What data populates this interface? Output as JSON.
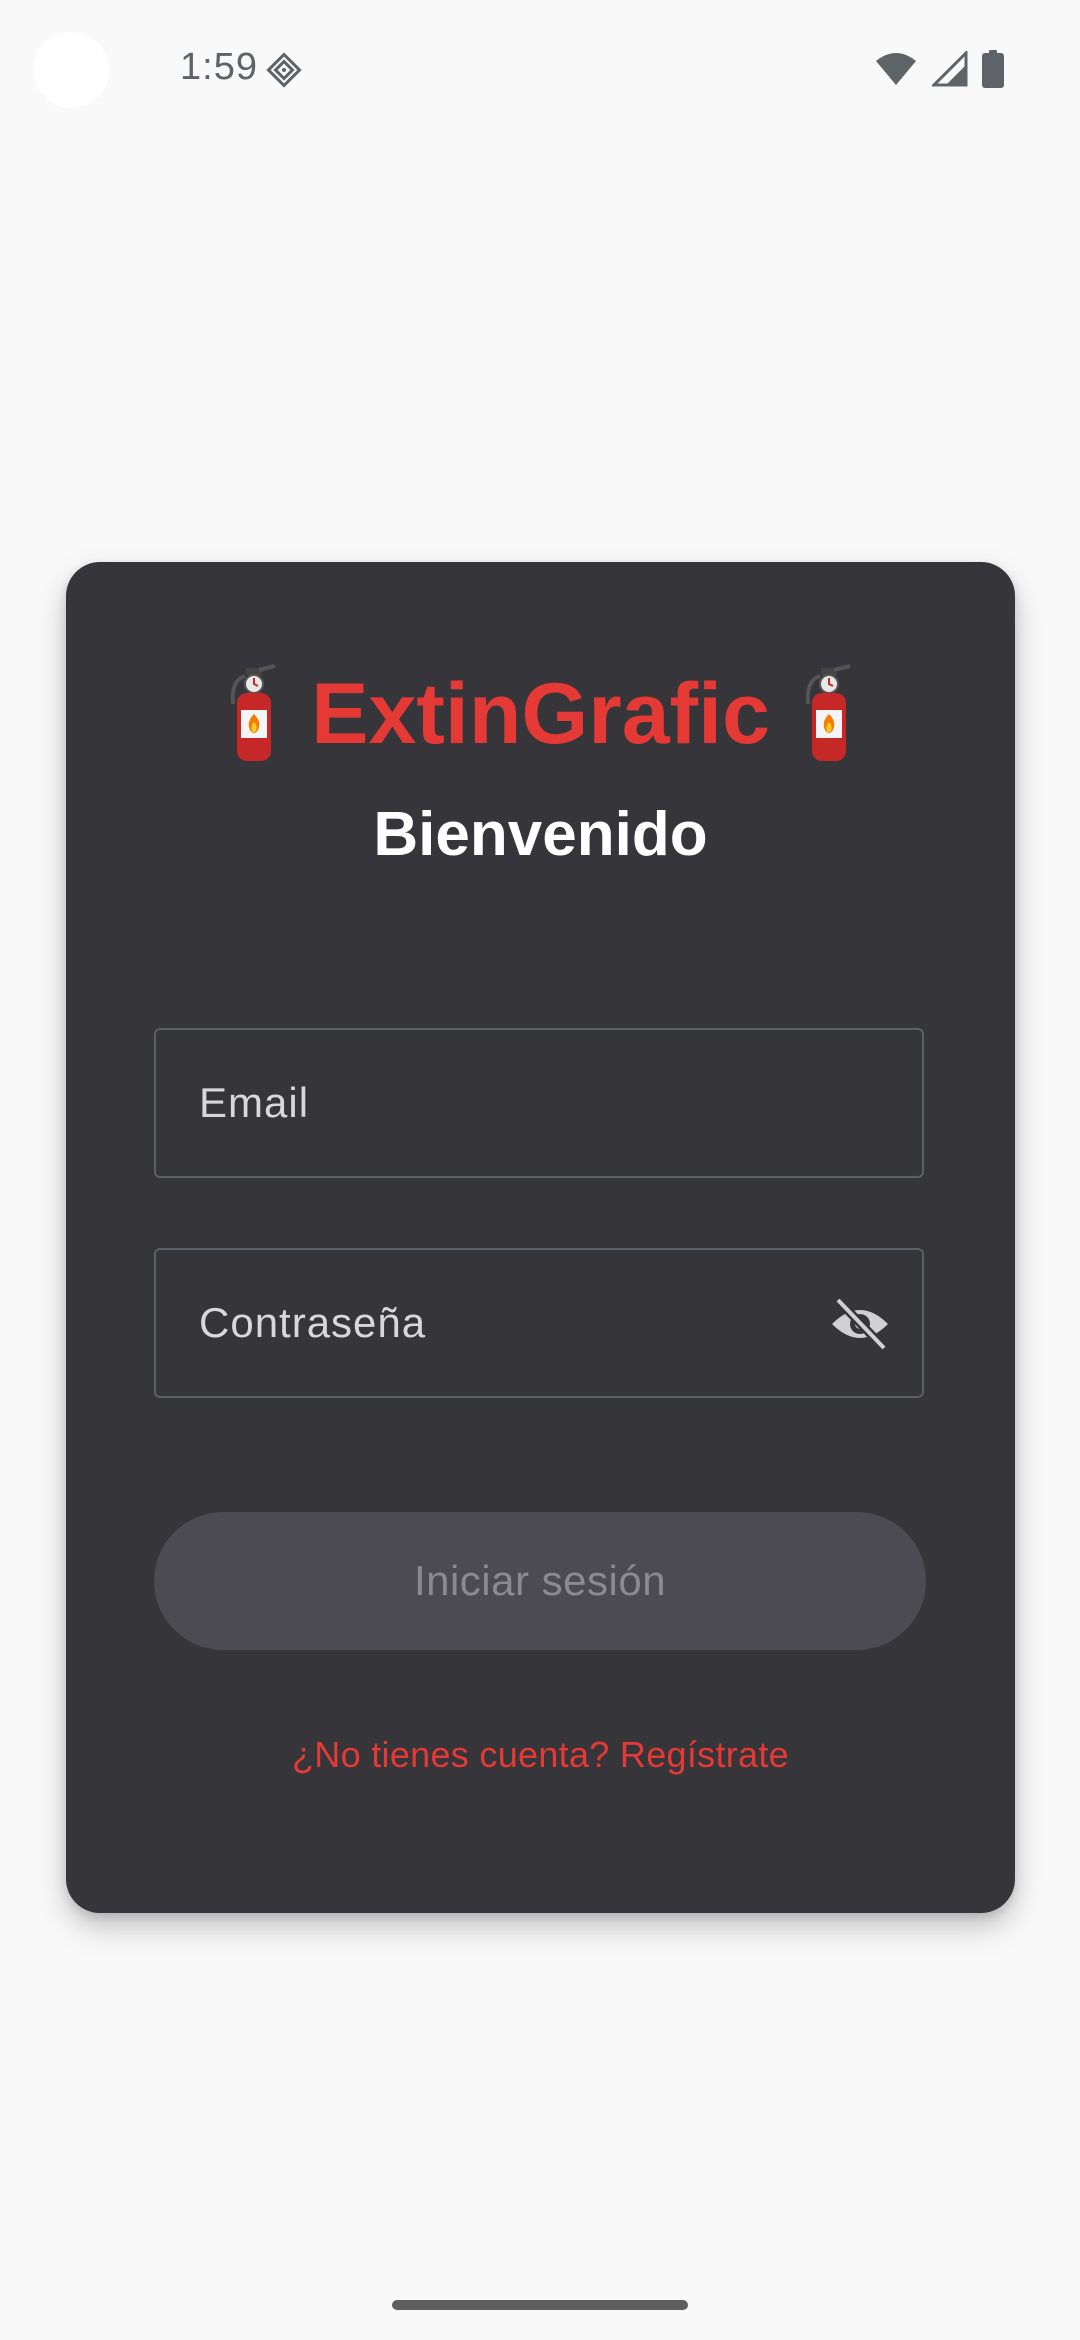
{
  "status_bar": {
    "time": "1:59",
    "icons": [
      "app-notification-icon",
      "wifi-icon",
      "signal-icon",
      "battery-icon"
    ]
  },
  "login_card": {
    "app_name": "ExtinGrafic",
    "brand_icon": "fire-extinguisher-icon",
    "welcome": "Bienvenido",
    "email_field": {
      "label": "Email",
      "value": ""
    },
    "password_field": {
      "label": "Contraseña",
      "value": "",
      "toggle_icon": "eye-off-icon"
    },
    "login_button": "Iniciar sesión",
    "register_link": "¿No tienes cuenta? Regístrate"
  },
  "colors": {
    "accent": "#e53935",
    "card_background": "#36353a",
    "page_background": "#f9f9f9",
    "button_disabled": "#4c4b51"
  }
}
